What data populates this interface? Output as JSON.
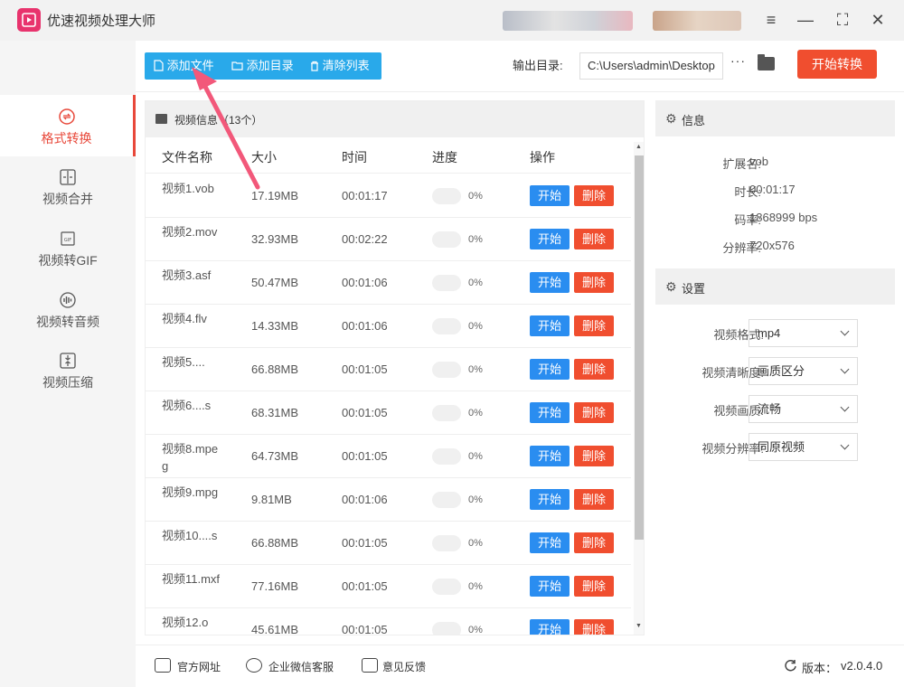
{
  "app": {
    "title": "优速视频处理大师"
  },
  "window": {
    "menu_icon": "≡",
    "minimize_icon": "—",
    "maximize_icon": "⛶",
    "close_icon": "✕"
  },
  "sidebar": {
    "items": [
      {
        "label": "格式转换",
        "icon": "convert-icon",
        "active": true
      },
      {
        "label": "视频合并",
        "icon": "merge-icon",
        "active": false
      },
      {
        "label": "视频转GIF",
        "icon": "gif-icon",
        "active": false
      },
      {
        "label": "视频转音频",
        "icon": "audio-icon",
        "active": false
      },
      {
        "label": "视频压缩",
        "icon": "compress-icon",
        "active": false
      }
    ]
  },
  "toolbar": {
    "add_file": "添加文件",
    "add_folder": "添加目录",
    "clear_list": "清除列表",
    "output_label": "输出目录:",
    "output_path": "C:\\Users\\admin\\Desktop",
    "more": "···",
    "start_convert": "开始转换"
  },
  "file_panel": {
    "title": "视频信息（13个）",
    "columns": [
      "文件名称",
      "大小",
      "时间",
      "进度",
      "操作"
    ],
    "start_label": "开始",
    "delete_label": "删除",
    "rows": [
      {
        "name": "视频1.vob",
        "size": "17.19MB",
        "time": "00:01:17",
        "progress": "0%"
      },
      {
        "name": "视频2.mov",
        "size": "32.93MB",
        "time": "00:02:22",
        "progress": "0%"
      },
      {
        "name": "视频3.asf",
        "size": "50.47MB",
        "time": "00:01:06",
        "progress": "0%"
      },
      {
        "name": "视频4.flv",
        "size": "14.33MB",
        "time": "00:01:06",
        "progress": "0%"
      },
      {
        "name": "视频5....",
        "size": "66.88MB",
        "time": "00:01:05",
        "progress": "0%"
      },
      {
        "name": "视频6....s",
        "size": "68.31MB",
        "time": "00:01:05",
        "progress": "0%"
      },
      {
        "name": "视频8.mpeg",
        "size": "64.73MB",
        "time": "00:01:05",
        "progress": "0%"
      },
      {
        "name": "视频9.mpg",
        "size": "9.81MB",
        "time": "00:01:06",
        "progress": "0%"
      },
      {
        "name": "视频10....s",
        "size": "66.88MB",
        "time": "00:01:05",
        "progress": "0%"
      },
      {
        "name": "视频11.mxf",
        "size": "77.16MB",
        "time": "00:01:05",
        "progress": "0%"
      },
      {
        "name": "视频12.o",
        "size": "45.61MB",
        "time": "00:01:05",
        "progress": "0%"
      }
    ]
  },
  "info": {
    "title": "信息",
    "fields": [
      {
        "label": "扩展名:",
        "value": "vob"
      },
      {
        "label": "时长:",
        "value": "00:01:17"
      },
      {
        "label": "码率:",
        "value": "1868999 bps"
      },
      {
        "label": "分辨率:",
        "value": "720x576"
      }
    ]
  },
  "settings": {
    "title": "设置",
    "fields": [
      {
        "label": "视频格式:",
        "value": "mp4"
      },
      {
        "label": "视频清晰度:",
        "value": "画质区分"
      },
      {
        "label": "视频画质:",
        "value": "流畅"
      },
      {
        "label": "视频分辨率:",
        "value": "同原视频"
      }
    ]
  },
  "footer": {
    "website": "官方网址",
    "wechat": "企业微信客服",
    "feedback": "意见反馈",
    "version_label": "版本：",
    "version": "v2.0.4.0"
  },
  "colors": {
    "accent_red": "#f04e2f",
    "accent_blue": "#29a9ea",
    "button_blue": "#2a8df0",
    "annotation_arrow": "#f2587a"
  }
}
